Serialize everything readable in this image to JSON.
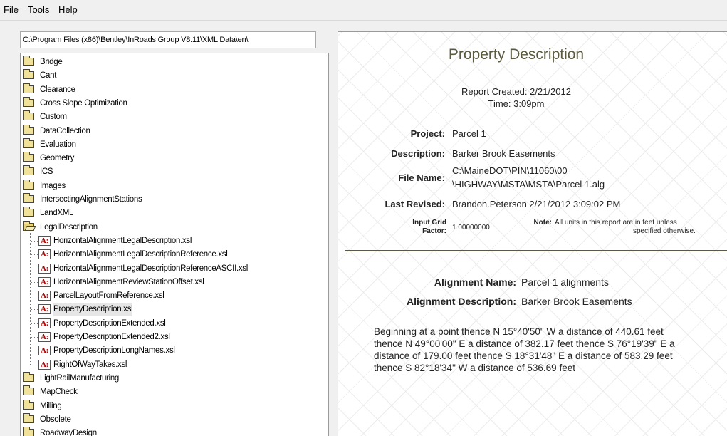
{
  "menu": [
    "File",
    "Tools",
    "Help"
  ],
  "path": "C:\\Program Files (x86)\\Bentley\\InRoads Group V8.11\\XML Data\\en\\",
  "tree": {
    "folders_before": [
      "Bridge",
      "Cant",
      "Clearance",
      "Cross Slope Optimization",
      "Custom",
      "DataCollection",
      "Evaluation",
      "Geometry",
      "ICS",
      "Images",
      "IntersectingAlignmentStations",
      "LandXML"
    ],
    "open_folder": "LegalDescription",
    "files": [
      "HorizontalAlignmentLegalDescription.xsl",
      "HorizontalAlignmentLegalDescriptionReference.xsl",
      "HorizontalAlignmentLegalDescriptionReferenceASCII.xsl",
      "HorizontalAlignmentReviewStationOffset.xsl",
      "ParcelLayoutFromReference.xsl",
      "PropertyDescription.xsl",
      "PropertyDescriptionExtended.xsl",
      "PropertyDescriptionExtended2.xsl",
      "PropertyDescriptionLongNames.xsl",
      "RightOfWayTakes.xsl"
    ],
    "selected_file": "PropertyDescription.xsl",
    "folders_after": [
      "LightRailManufacturing",
      "MapCheck",
      "Milling",
      "Obsolete",
      "RoadwayDesign"
    ],
    "file_icon_text": "A:"
  },
  "report": {
    "title": "Property Description",
    "created_line": "Report Created:  2/21/2012",
    "time_line": "Time:  3:09pm",
    "project_label": "Project:",
    "project": "Parcel 1",
    "description_label": "Description:",
    "description": "Barker Brook Easements",
    "filename_label": "File Name:",
    "filename_1": "C:\\MaineDOT\\PIN\\11060\\00",
    "filename_2": "\\HIGHWAY\\MSTA\\MSTA\\Parcel 1.alg",
    "revised_label": "Last Revised:",
    "revised": "Brandon.Peterson 2/21/2012 3:09:02 PM",
    "grid_label_1": "Input Grid",
    "grid_label_2": "Factor:",
    "grid_value": "1.00000000",
    "note_label": "Note:",
    "note_1": "All units in this report are in feet unless",
    "note_2": "specified otherwise.",
    "alignment_name_label": "Alignment Name:",
    "alignment_name": "Parcel 1 alignments",
    "alignment_desc_label": "Alignment Description:",
    "alignment_desc": "Barker Brook Easements",
    "paragraph": "Beginning at a point thence N 15°40'50\" W a distance of 440.61 feet thence N 49°00'00\" E a distance of 382.17 feet thence S 76°19'39\" E a distance of 179.00 feet thence S 18°31'48\" E a distance of 583.29 feet thence S 82°18'34\" W a distance of 536.69 feet"
  }
}
